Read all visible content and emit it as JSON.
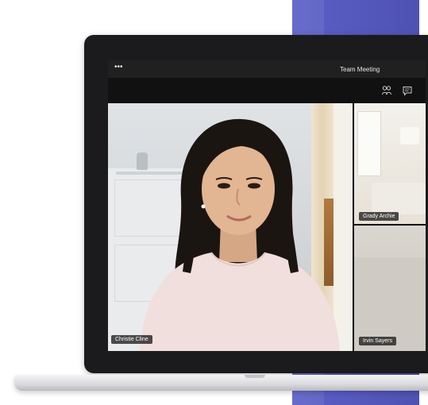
{
  "window": {
    "title": "Team Meeting",
    "more_icon": "more-dots-icon"
  },
  "toolbar": {
    "icons": [
      "participants-icon",
      "chat-icon"
    ]
  },
  "participants": {
    "main": {
      "name": "Christie Cline"
    },
    "side": [
      {
        "name": "Grady Archie"
      },
      {
        "name": "Irvin Sayers"
      }
    ]
  },
  "colors": {
    "backdrop": "#5b5fc7",
    "titlebar": "#202020",
    "toolbar": "#111112",
    "label_bg": "#141414"
  }
}
